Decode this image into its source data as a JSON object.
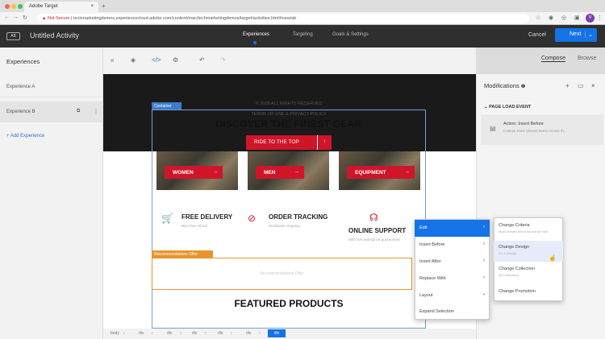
{
  "browser": {
    "tab_title": "Adobe Target",
    "not_secure": "Not Secure",
    "url": "techmarketingdemos.experiencecloud.adobe.com/content/mac/techmarketingdemos/target/activities.html#new/ab"
  },
  "header": {
    "logo": "AB",
    "activity_title": "Untitled Activity",
    "steps": [
      "Experiences",
      "Targeting",
      "Goals & Settings"
    ],
    "cancel": "Cancel",
    "next": "Next"
  },
  "left_panel": {
    "title": "Experiences",
    "experiences": [
      "Experience A",
      "Experience B"
    ],
    "add_experience": "+ Add Experience"
  },
  "toolbar": {
    "compose": "Compose",
    "browse": "Browse"
  },
  "canvas": {
    "container_label": "Container",
    "footer_line1": "© 2018 ALL RIGHTS RESERVED",
    "footer_line2": "TERMS OF USE & PRIVACY POLICY",
    "headline": "DISCOVER THE FINEST GEAR",
    "ride_button": "RIDE TO THE TOP",
    "categories": [
      "WOMEN",
      "MEN",
      "EQUIPMENT"
    ],
    "features": [
      {
        "title": "FREE DELIVERY",
        "sub": "Best free refund"
      },
      {
        "title": "ORDER TRACKING",
        "sub": "Worldwide shipping"
      },
      {
        "title": "ONLINE SUPPORT",
        "sub": "With live assistance guaranteed"
      }
    ],
    "reco_label": "Recommendations Offer",
    "reco_placeholder": "Recommendations Offer",
    "featured": "FEATURED PRODUCTS",
    "breadcrumb": [
      "body",
      "div",
      "div",
      "div",
      "div",
      "div",
      "div",
      "div",
      "div"
    ],
    "breadcrumb_active": "div"
  },
  "right_panel": {
    "title": "Modifications",
    "page_load_event": "PAGE LOAD EVENT",
    "action_title": "Action: Insert Before",
    "action_sub": "Criteria: Most Viewed Items Across th..."
  },
  "context_menu": {
    "items": [
      "Edit",
      "Insert Before",
      "Insert After",
      "Replace With",
      "Layout",
      "Expand Selection"
    ],
    "active": "Edit"
  },
  "submenu": {
    "items": [
      {
        "label": "Change Criteria",
        "sub": "Most Viewed Items Across the Site"
      },
      {
        "label": "Change Design",
        "sub": "4 x 1 Design"
      },
      {
        "label": "Change Collection",
        "sub": "All Collections"
      },
      {
        "label": "Change Promotion",
        "sub": ""
      }
    ]
  }
}
